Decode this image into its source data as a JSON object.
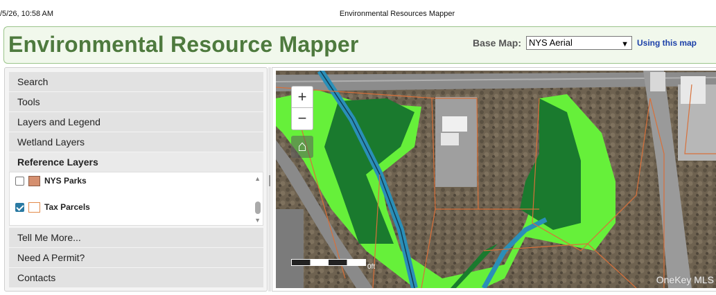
{
  "print": {
    "date": "/5/26, 10:58 AM",
    "title": "Environmental Resources Mapper"
  },
  "header": {
    "title": "Environmental Resource Mapper",
    "basemap_label": "Base Map:",
    "basemap_value": "NYS Aerial",
    "using_link": "Using this map"
  },
  "menu": {
    "search": "Search",
    "tools": "Tools",
    "layers_legend": "Layers and Legend",
    "wetland": "Wetland Layers",
    "reference": "Reference Layers",
    "tell_more": "Tell Me More...",
    "permit": "Need A Permit?",
    "contacts": "Contacts"
  },
  "reference_layers": [
    {
      "label": "NYS Parks",
      "checked": false
    },
    {
      "label": "Tax Parcels",
      "checked": true
    }
  ],
  "map": {
    "zoom_in": "+",
    "zoom_out": "−",
    "home": "⌂",
    "scale_label": "0ft",
    "watermark": "OneKey MLS"
  },
  "colors": {
    "wetland_light": "#66f03a",
    "wetland_dark": "#1a7a2e",
    "stream": "#2a8fb8",
    "parcel_line": "#d8703a"
  }
}
